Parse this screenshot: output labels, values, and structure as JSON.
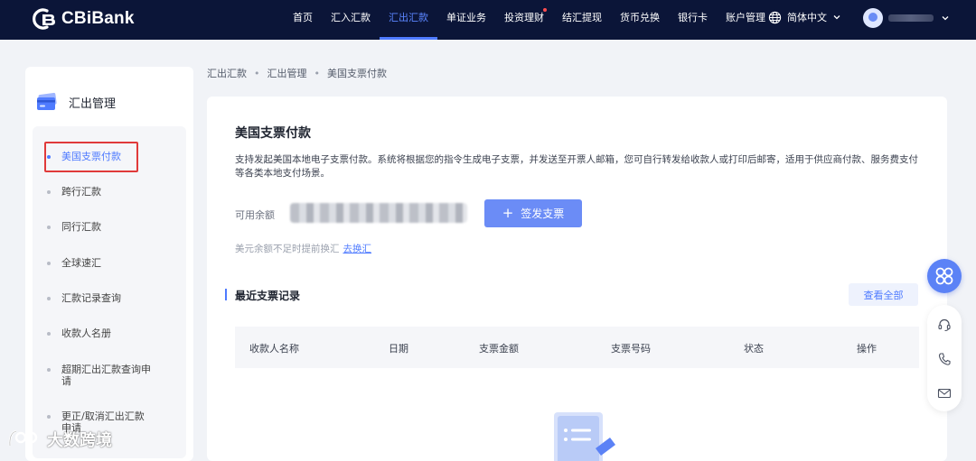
{
  "brand": {
    "name": "CBiBank"
  },
  "nav": {
    "items": [
      {
        "label": "首页",
        "active": false
      },
      {
        "label": "汇入汇款",
        "active": false
      },
      {
        "label": "汇出汇款",
        "active": true
      },
      {
        "label": "单证业务",
        "active": false
      },
      {
        "label": "投资理财",
        "active": false,
        "badge": true
      },
      {
        "label": "结汇提现",
        "active": false
      },
      {
        "label": "货币兑换",
        "active": false
      },
      {
        "label": "银行卡",
        "active": false
      },
      {
        "label": "账户管理",
        "active": false
      }
    ],
    "language": "简体中文"
  },
  "sidebar": {
    "title": "汇出管理",
    "items": [
      {
        "label": "美国支票付款",
        "active": true
      },
      {
        "label": "跨行汇款"
      },
      {
        "label": "同行汇款"
      },
      {
        "label": "全球速汇"
      },
      {
        "label": "汇款记录查询"
      },
      {
        "label": "收款人名册"
      },
      {
        "label": "超期汇出汇款查询申请"
      },
      {
        "label": "更正/取消汇出汇款申请"
      }
    ]
  },
  "breadcrumb": [
    "汇出汇款",
    "汇出管理",
    "美国支票付款"
  ],
  "main": {
    "title": "美国支票付款",
    "description": "支持发起美国本地电子支票付款。系统将根据您的指令生成电子支票，并发送至开票人邮箱，您可自行转发给收款人或打印后邮寄，适用于供应商付款、服务费支付等各类本地支付场景。",
    "balance_label": "可用余额",
    "issue_button": "签发支票",
    "hint_text": "美元余额不足时提前换汇",
    "hint_link": "去换汇",
    "records_title": "最近支票记录",
    "view_all": "查看全部",
    "table_headers": [
      "收款人名称",
      "日期",
      "支票金额",
      "支票号码",
      "状态",
      "操作"
    ]
  },
  "float_tools": [
    "apps-icon",
    "headset-icon",
    "phone-icon",
    "mail-icon"
  ],
  "watermark": "大数跨境",
  "colors": {
    "topbar": "#0b1538",
    "accent": "#4f7bff",
    "button": "#6b8cf6",
    "highlight_box": "#e03a3a"
  }
}
